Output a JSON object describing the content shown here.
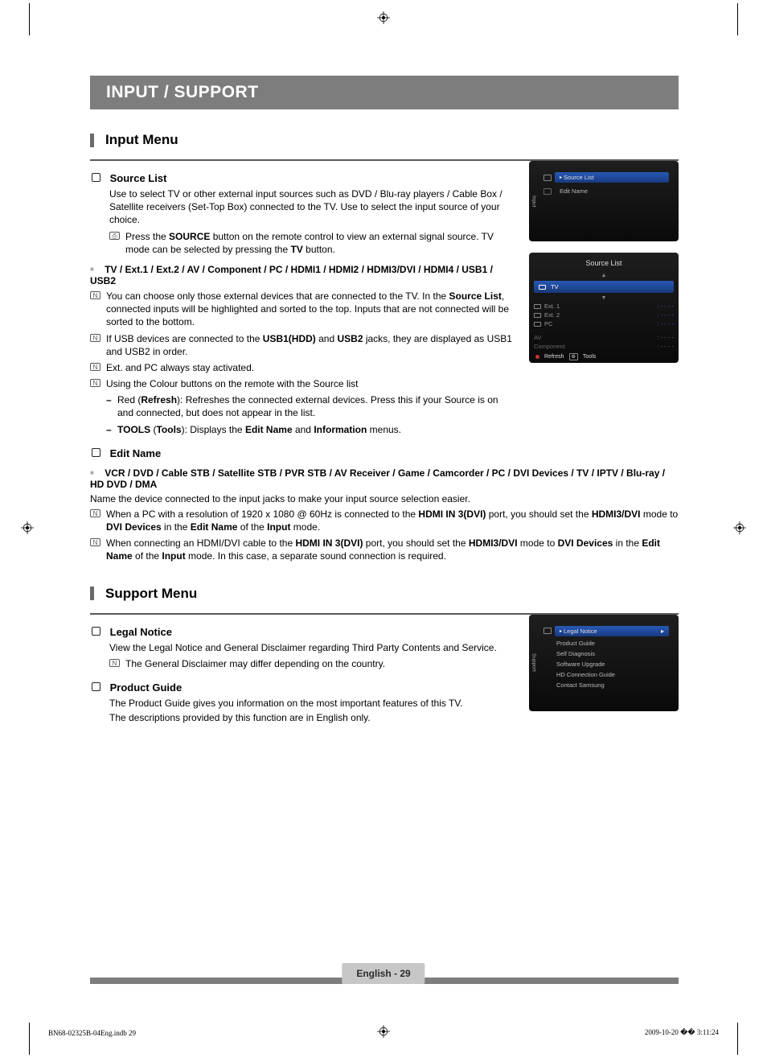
{
  "banner": "INPUT / SUPPORT",
  "sections": {
    "input_menu": "Input Menu",
    "support_menu": "Support Menu"
  },
  "source_list": {
    "heading": "Source List",
    "desc": "Use to select TV or other external input sources such as DVD / Blu-ray players / Cable Box / Satellite receivers (Set-Top Box) connected to the TV. Use to select the input source of your choice.",
    "note_source_btn_pre": "Press the ",
    "note_source_btn_b1": "SOURCE",
    "note_source_btn_mid": " button on the remote control to view an external signal source. TV mode can be selected by pressing the ",
    "note_source_btn_b2": "TV",
    "note_source_btn_post": " button."
  },
  "inputs_item": {
    "heading": "TV / Ext.1 / Ext.2 / AV / Component / PC / HDMI1 / HDMI2 / HDMI3/DVI / HDMI4 / USB1 / USB2",
    "n1_pre": "You can choose only those external devices that are connected to the TV. In the ",
    "n1_b": "Source List",
    "n1_post": ", connected inputs will be highlighted and sorted to the top. Inputs that are not connected will be sorted to the bottom.",
    "n2_pre": "If USB devices are connected to the ",
    "n2_b1": "USB1(HDD)",
    "n2_mid": " and ",
    "n2_b2": "USB2",
    "n2_post": " jacks, they are displayed as USB1 and USB2 in order.",
    "n3": "Ext. and PC always stay activated.",
    "n4": "Using the Colour buttons on the remote with the Source list",
    "d1_pre": "Red (",
    "d1_b": "Refresh",
    "d1_post": "): Refreshes the connected external devices. Press this if your Source is on and connected, but does not appear in the list.",
    "d2_b1": "TOOLS",
    "d2_mid": " (",
    "d2_b2": "Tools",
    "d2_mid2": "): Displays the ",
    "d2_b3": "Edit Name",
    "d2_mid3": " and ",
    "d2_b4": "Information",
    "d2_post": " menus."
  },
  "edit_name": {
    "heading": "Edit Name",
    "sub_heading": "VCR / DVD / Cable STB / Satellite STB / PVR STB / AV Receiver / Game / Camcorder / PC / DVI Devices / TV / IPTV / Blu-ray / HD DVD / DMA",
    "desc": "Name the device connected to the input jacks to make your input source selection easier.",
    "n1_pre": "When a PC with a resolution of 1920 x 1080 @ 60Hz is connected to the ",
    "n1_b1": "HDMI IN 3(DVI)",
    "n1_mid1": " port, you should set the ",
    "n1_b2": "HDMI3/DVI",
    "n1_mid2": " mode to ",
    "n1_b3": "DVI Devices",
    "n1_mid3": " in the ",
    "n1_b4": "Edit Name",
    "n1_mid4": " of the ",
    "n1_b5": "Input",
    "n1_post": " mode.",
    "n2_pre": "When connecting an HDMI/DVI cable to the ",
    "n2_b1": "HDMI IN 3(DVI)",
    "n2_mid1": " port, you should set the ",
    "n2_b2": "HDMI3/DVI",
    "n2_mid2": " mode to ",
    "n2_b3": "DVI Devices",
    "n2_mid3": " in the ",
    "n2_b4": "Edit Name",
    "n2_mid4": " of the ",
    "n2_b5": "Input",
    "n2_post": " mode. In this case, a separate sound connection is required."
  },
  "legal_notice": {
    "heading": "Legal Notice",
    "desc": "View the Legal Notice and General Disclaimer regarding Third Party Contents and Service.",
    "note": "The General Disclaimer may differ depending on the country."
  },
  "product_guide": {
    "heading": "Product Guide",
    "l1": "The Product Guide gives you information on the most important features of this TV.",
    "l2": "The descriptions provided by this function are in English only."
  },
  "osd1": {
    "tab": "Input",
    "sel": "Source List",
    "i2": "Edit Name"
  },
  "osd2": {
    "title": "Source List",
    "tv": "TV",
    "e1": "Ext. 1",
    "e2": "Ext. 2",
    "pc": "PC",
    "av": "AV",
    "comp": "Component",
    "dash": "- - - -",
    "refresh": "Refresh",
    "tools": "Tools"
  },
  "osd3": {
    "tab": "Support",
    "sel": "Legal Notice",
    "i1": "Product Guide",
    "i2": "Self Diagnosis",
    "i3": "Software Upgrade",
    "i4": "HD Connection Guide",
    "i5": "Contact Samsung"
  },
  "page_label": "English - 29",
  "footer": {
    "left": "BN68-02325B-04Eng.indb   29",
    "right": "2009-10-20   �� 3:11:24"
  }
}
